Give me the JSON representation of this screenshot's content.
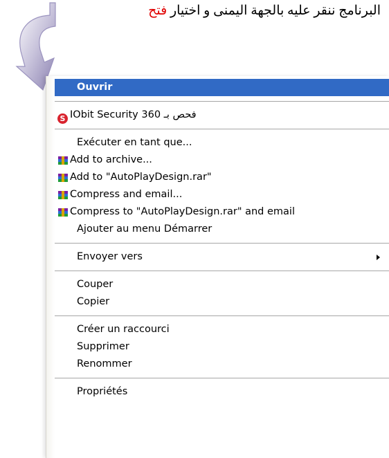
{
  "caption": {
    "text": "البرنامج ننقر عليه بالجهة اليمنى و اختيار",
    "accent": "فتح",
    "accent_color": "#e00000"
  },
  "menu": {
    "highlight_color": "#316ac5",
    "open": "Ouvrir",
    "iobit_icon": "iobit-shield-icon",
    "iobit_glyph": "S",
    "iobit_label": "IObit Security 360 فحص بـ",
    "run_as": "Exécuter en tant que...",
    "rar_icon": "winrar-books-icon",
    "add_archive": "Add to archive...",
    "add_named": "Add to \"AutoPlayDesign.rar\"",
    "compress_email": "Compress and email...",
    "compress_named_email": "Compress to \"AutoPlayDesign.rar\" and email",
    "pin_start": "Ajouter au menu Démarrer",
    "send_to": "Envoyer vers",
    "cut": "Couper",
    "copy": "Copier",
    "shortcut": "Créer un raccourci",
    "delete": "Supprimer",
    "rename": "Renommer",
    "properties": "Propriétés"
  }
}
